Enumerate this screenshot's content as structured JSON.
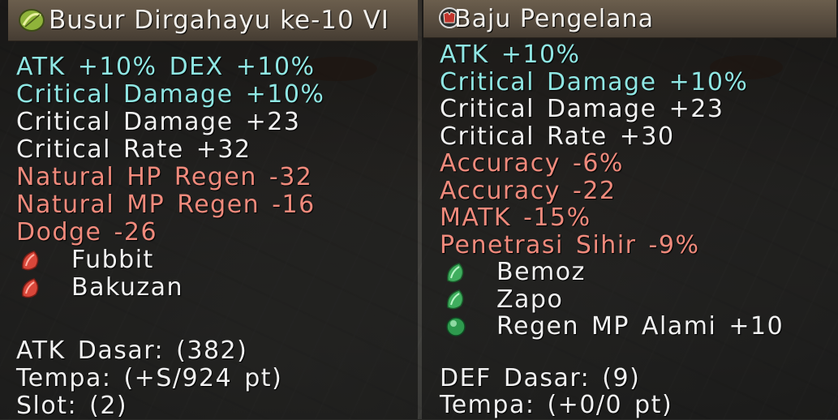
{
  "left_card": {
    "title": "Busur Dirgahayu ke-10 VI",
    "icon": "bow-icon",
    "stats": [
      {
        "text": "ATK +10% DEX +10%",
        "color": "cyan"
      },
      {
        "text": "Critical Damage +10%",
        "color": "cyan"
      },
      {
        "text": "Critical Damage +23",
        "color": "white"
      },
      {
        "text": "Critical Rate +32",
        "color": "white"
      },
      {
        "text": "Natural HP Regen -32",
        "color": "red"
      },
      {
        "text": "Natural MP Regen -16",
        "color": "red"
      },
      {
        "text": "Dodge -26",
        "color": "red"
      }
    ],
    "crysta": [
      {
        "name": "Fubbit",
        "icon": "red-crysta-icon"
      },
      {
        "name": "Bakuzan",
        "icon": "red-crysta-icon"
      }
    ],
    "base": [
      "ATK Dasar: (382)",
      "Tempa: (+S/924 pt)",
      "Slot: (2)"
    ]
  },
  "right_card": {
    "title": "Baju Pengelana",
    "icon": "armor-icon",
    "stats": [
      {
        "text": "ATK +10%",
        "color": "cyan"
      },
      {
        "text": "Critical Damage +10%",
        "color": "cyan"
      },
      {
        "text": "Critical Damage +23",
        "color": "white"
      },
      {
        "text": "Critical Rate +30",
        "color": "white"
      },
      {
        "text": "Accuracy -6%",
        "color": "red"
      },
      {
        "text": "Accuracy -22",
        "color": "red"
      },
      {
        "text": "MATK -15%",
        "color": "red"
      },
      {
        "text": "Penetrasi Sihir -9%",
        "color": "red"
      }
    ],
    "crysta": [
      {
        "name": "Bemoz",
        "icon": "green-crysta-icon"
      },
      {
        "name": "Zapo",
        "icon": "green-crysta-icon"
      },
      {
        "name": "Regen MP Alami +10",
        "icon": "green-orb-icon"
      }
    ],
    "base": [
      "DEF Dasar: (9)",
      "Tempa: (+0/0 pt)"
    ]
  },
  "colors": {
    "cyan": "#8fe6e3",
    "white": "#f1f1f1",
    "red": "#f08a7c",
    "title_bar": "#564b3e"
  }
}
